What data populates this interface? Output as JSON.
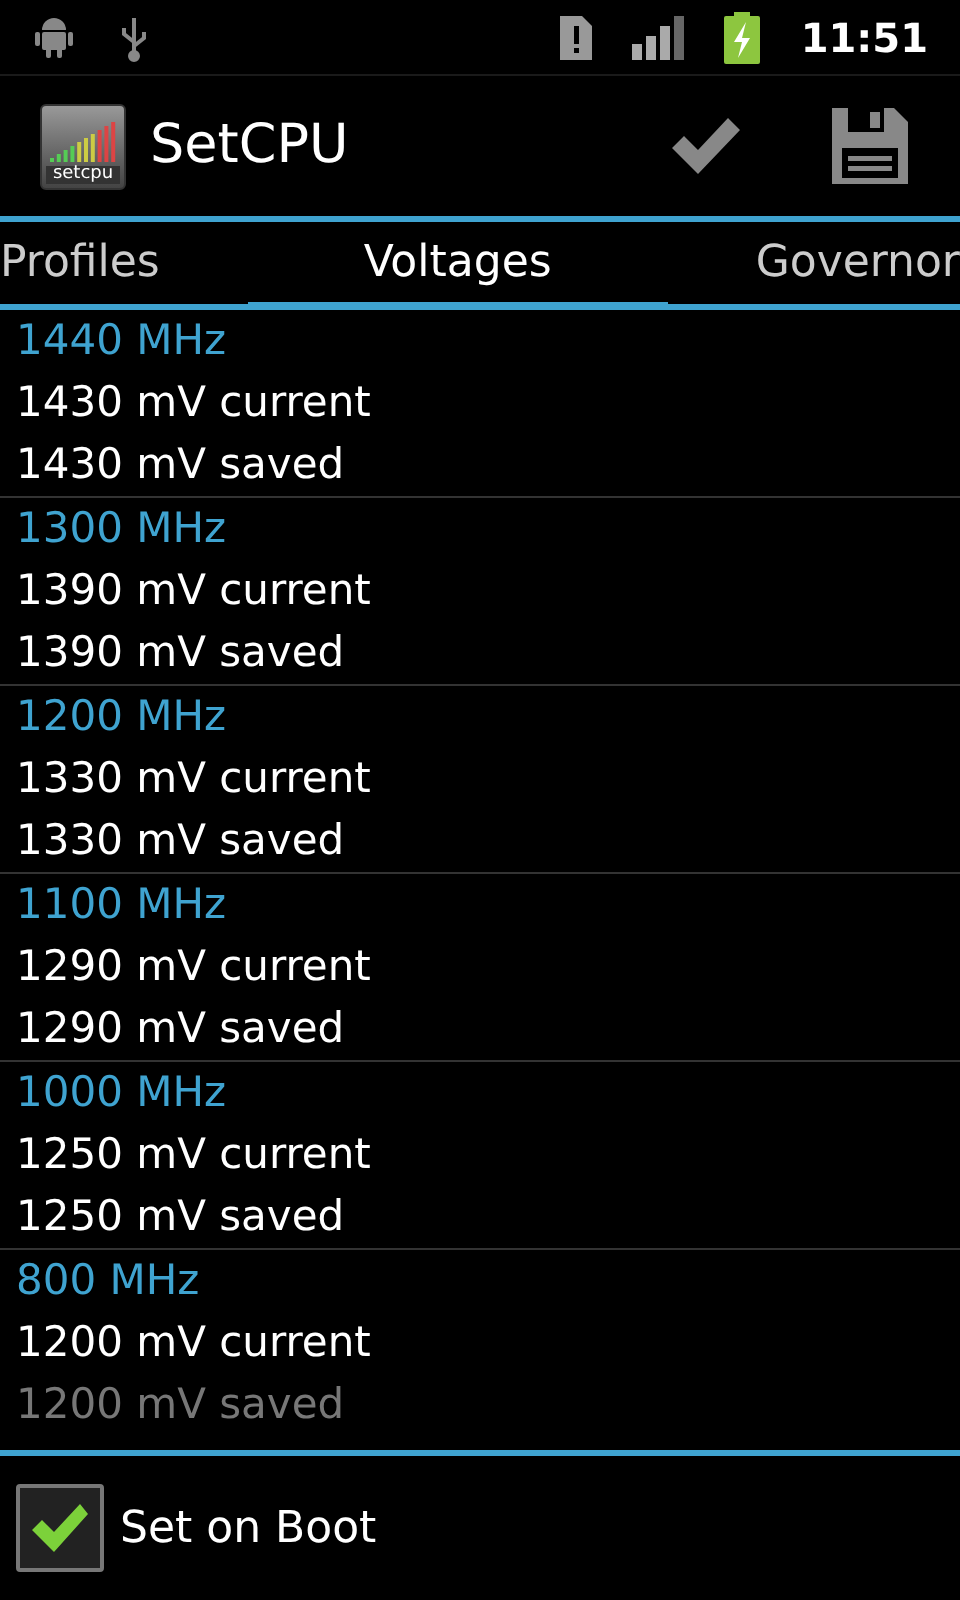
{
  "status_bar": {
    "time": "11:51"
  },
  "app_bar": {
    "title": "SetCPU",
    "logo_text": "setcpu"
  },
  "tabs": [
    {
      "label": "Profiles",
      "selected": false
    },
    {
      "label": "Voltages",
      "selected": true
    },
    {
      "label": "Governor",
      "selected": false
    }
  ],
  "voltages": [
    {
      "frequency": "1440 MHz",
      "current": "1430 mV current",
      "saved": "1430 mV saved"
    },
    {
      "frequency": "1300 MHz",
      "current": "1390 mV current",
      "saved": "1390 mV saved"
    },
    {
      "frequency": "1200 MHz",
      "current": "1330 mV current",
      "saved": "1330 mV saved"
    },
    {
      "frequency": "1100 MHz",
      "current": "1290 mV current",
      "saved": "1290 mV saved"
    },
    {
      "frequency": "1000 MHz",
      "current": "1250 mV current",
      "saved": "1250 mV saved"
    },
    {
      "frequency": "800 MHz",
      "current": "1200 mV current",
      "saved": "1200 mV saved"
    }
  ],
  "set_on_boot": {
    "label": "Set on Boot",
    "checked": true
  }
}
